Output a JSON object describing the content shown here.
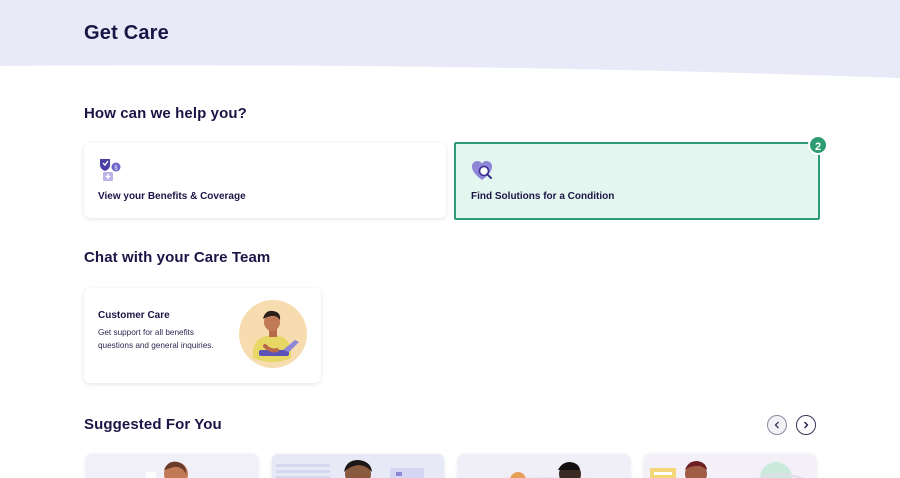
{
  "header": {
    "title": "Get Care",
    "background_color": "#e8eaf8"
  },
  "help": {
    "title": "How can we help you?",
    "cards": [
      {
        "label": "View your Benefits & Coverage",
        "icon": "benefits-shield-icon"
      },
      {
        "label": "Find Solutions for a Condition",
        "icon": "heart-search-icon",
        "selected": true
      }
    ],
    "badge": "2",
    "accent_color": "#2f9b73"
  },
  "chat": {
    "title": "Chat with your Care Team",
    "customer_care": {
      "title": "Customer Care",
      "description": "Get support for all benefits questions and general inquiries.",
      "illustration": "support-agent-illustration"
    }
  },
  "suggested": {
    "title": "Suggested For You",
    "prev_icon": "chevron-left-icon",
    "next_icon": "chevron-right-icon"
  },
  "colors": {
    "text_primary": "#1b1546",
    "brand_purple": "#5b52b8",
    "selected_bg": "#e3f6ef"
  }
}
